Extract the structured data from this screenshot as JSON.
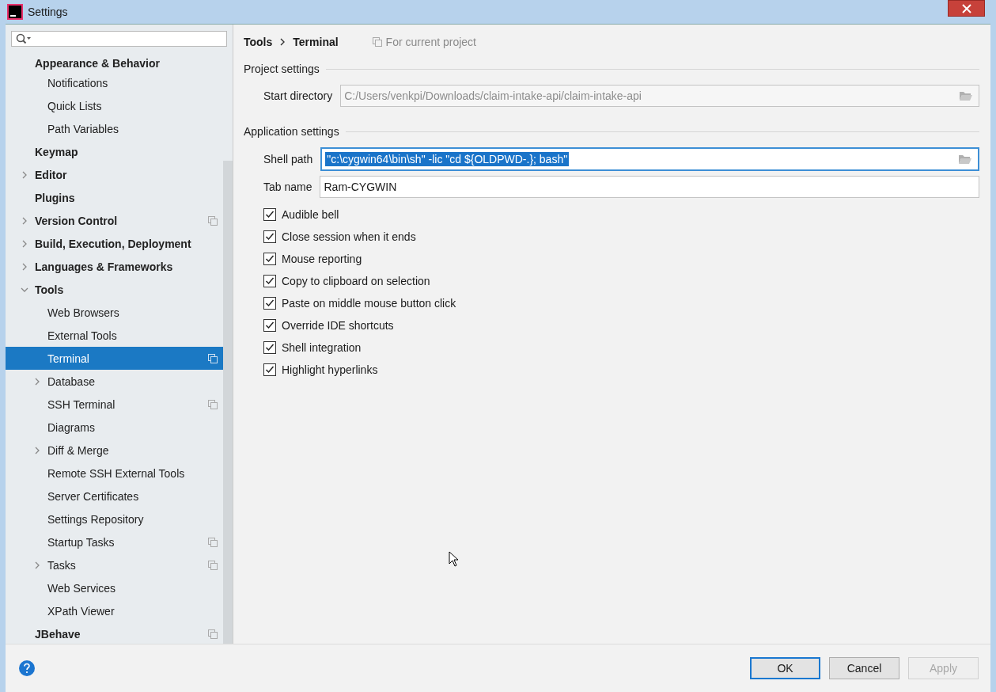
{
  "window": {
    "title": "Settings"
  },
  "sidebar": {
    "items": [
      {
        "label": "Appearance & Behavior",
        "selected": false,
        "project_scoped": false,
        "children": [
          {
            "label": "Notifications",
            "selected": false,
            "project_scoped": false
          },
          {
            "label": "Quick Lists",
            "selected": false,
            "project_scoped": false
          },
          {
            "label": "Path Variables",
            "selected": false,
            "project_scoped": false
          }
        ]
      },
      {
        "label": "Keymap",
        "selected": false,
        "project_scoped": false
      },
      {
        "label": "Editor",
        "selected": false,
        "project_scoped": false,
        "expanded": false
      },
      {
        "label": "Plugins",
        "selected": false,
        "project_scoped": false
      },
      {
        "label": "Version Control",
        "selected": false,
        "project_scoped": true,
        "expanded": false
      },
      {
        "label": "Build, Execution, Deployment",
        "selected": false,
        "project_scoped": false,
        "expanded": false
      },
      {
        "label": "Languages & Frameworks",
        "selected": false,
        "project_scoped": false,
        "expanded": false
      },
      {
        "label": "Tools",
        "selected": false,
        "project_scoped": false,
        "expanded": true,
        "children": [
          {
            "label": "Web Browsers",
            "selected": false,
            "project_scoped": false
          },
          {
            "label": "External Tools",
            "selected": false,
            "project_scoped": false
          },
          {
            "label": "Terminal",
            "selected": true,
            "project_scoped": true
          },
          {
            "label": "Database",
            "selected": false,
            "project_scoped": false,
            "expanded": false
          },
          {
            "label": "SSH Terminal",
            "selected": false,
            "project_scoped": true
          },
          {
            "label": "Diagrams",
            "selected": false,
            "project_scoped": false
          },
          {
            "label": "Diff & Merge",
            "selected": false,
            "project_scoped": false,
            "expanded": false
          },
          {
            "label": "Remote SSH External Tools",
            "selected": false,
            "project_scoped": false
          },
          {
            "label": "Server Certificates",
            "selected": false,
            "project_scoped": false
          },
          {
            "label": "Settings Repository",
            "selected": false,
            "project_scoped": false
          },
          {
            "label": "Startup Tasks",
            "selected": false,
            "project_scoped": true
          },
          {
            "label": "Tasks",
            "selected": false,
            "project_scoped": true,
            "expanded": false
          },
          {
            "label": "Web Services",
            "selected": false,
            "project_scoped": false
          },
          {
            "label": "XPath Viewer",
            "selected": false,
            "project_scoped": false
          }
        ]
      },
      {
        "label": "JBehave",
        "selected": false,
        "project_scoped": true
      }
    ]
  },
  "breadcrumb": [
    "Tools",
    "Terminal"
  ],
  "scope_note": "For current project",
  "project_settings": {
    "heading": "Project settings",
    "start_directory": {
      "label": "Start directory",
      "value": "C:/Users/venkpi/Downloads/claim-intake-api/claim-intake-api",
      "disabled": true
    }
  },
  "application_settings": {
    "heading": "Application settings",
    "shell_path": {
      "label": "Shell path",
      "value": "\"c:\\cygwin64\\bin\\sh\" -lic \"cd ${OLDPWD-.}; bash\"",
      "selected_text": true
    },
    "tab_name": {
      "label": "Tab name",
      "value": "Ram-CYGWIN"
    },
    "options": [
      {
        "label": "Audible bell",
        "checked": true
      },
      {
        "label": "Close session when it ends",
        "checked": true
      },
      {
        "label": "Mouse reporting",
        "checked": true
      },
      {
        "label": "Copy to clipboard on selection",
        "checked": true
      },
      {
        "label": "Paste on middle mouse button click",
        "checked": true
      },
      {
        "label": "Override IDE shortcuts",
        "checked": true
      },
      {
        "label": "Shell integration",
        "checked": true
      },
      {
        "label": "Highlight hyperlinks",
        "checked": true
      }
    ]
  },
  "buttons": [
    {
      "label": "OK",
      "default": true,
      "disabled": false
    },
    {
      "label": "Cancel",
      "default": false,
      "disabled": false
    },
    {
      "label": "Apply",
      "default": false,
      "disabled": true
    }
  ]
}
